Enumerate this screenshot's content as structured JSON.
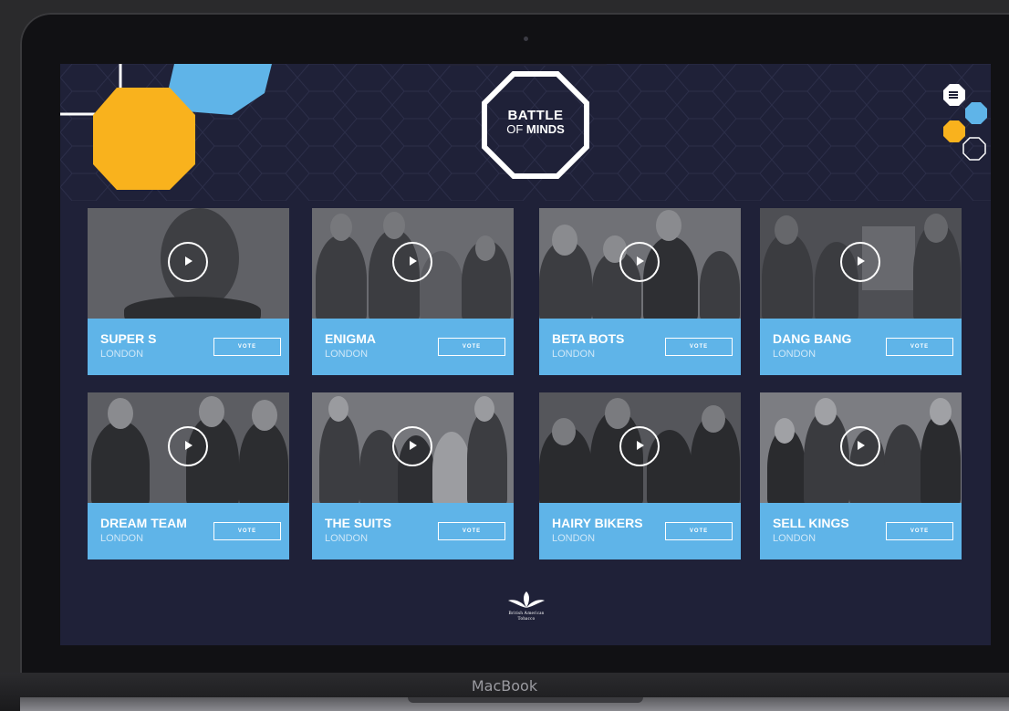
{
  "device": {
    "brand_label": "MacBook"
  },
  "app": {
    "logo": {
      "line1": "BATTLE",
      "line2_prefix": "OF",
      "line2_bold": "MINDS"
    },
    "menu": {
      "icon": "hamburger-icon"
    },
    "teams": [
      {
        "name": "SUPER S",
        "city": "LONDON",
        "vote_label": "VOTE"
      },
      {
        "name": "ENIGMA",
        "city": "LONDON",
        "vote_label": "VOTE"
      },
      {
        "name": "BETA BOTS",
        "city": "LONDON",
        "vote_label": "VOTE"
      },
      {
        "name": "DANG BANG",
        "city": "LONDON",
        "vote_label": "VOTE"
      },
      {
        "name": "DREAM TEAM",
        "city": "LONDON",
        "vote_label": "VOTE"
      },
      {
        "name": "THE SUITS",
        "city": "LONDON",
        "vote_label": "VOTE"
      },
      {
        "name": "HAIRY BIKERS",
        "city": "LONDON",
        "vote_label": "VOTE"
      },
      {
        "name": "SELL KINGS",
        "city": "LONDON",
        "vote_label": "VOTE"
      }
    ],
    "footer": {
      "sponsor_line1": "British American",
      "sponsor_line2": "Tobacco"
    }
  },
  "colors": {
    "background": "#1f2138",
    "accent_blue": "#5fb4e8",
    "accent_yellow": "#f9b21d",
    "text_white": "#ffffff"
  }
}
